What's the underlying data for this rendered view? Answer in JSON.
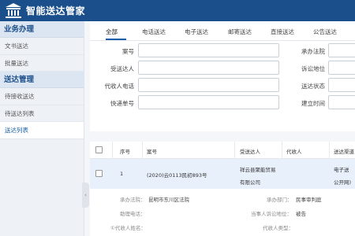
{
  "app": {
    "title": "智能送达管家"
  },
  "sidebar": {
    "sections": [
      {
        "label": "业务办理",
        "items": [
          {
            "label": "文书送达"
          },
          {
            "label": "批量送达"
          }
        ]
      },
      {
        "label": "送达管理",
        "items": [
          {
            "label": "待接收送达"
          },
          {
            "label": "待送达列表"
          },
          {
            "label": "送达列表"
          }
        ]
      }
    ],
    "active_item": "送达列表",
    "collapse_glyph": "‹"
  },
  "tabs": [
    "全部",
    "电话送达",
    "电子送达",
    "邮寄送达",
    "直接送达",
    "公告送达"
  ],
  "active_tab": "全部",
  "form": {
    "case_no": "案号",
    "recipient": "受送达人",
    "agent_phone": "代收人电话",
    "tracking_no": "快递单号",
    "court": "承办法院",
    "litigation_status": "诉讼地位",
    "delivery_status": "送达状态",
    "created_time": "建立时间"
  },
  "table": {
    "headers": [
      "序号",
      "案号",
      "受送达人",
      "代收人",
      "送达渠道"
    ],
    "rows": [
      {
        "index": "1",
        "case_no": "(2020)云0113民初893号",
        "recipient_line1": "祥云县聚能贸易",
        "recipient_line2": "有限公司",
        "agent": "",
        "channel_line1": "电子送",
        "channel_line2": "公开网)"
      }
    ],
    "detail": {
      "court_label": "承办法院：",
      "court_value": "昆明市东川区法院",
      "department_label": "承办部门：",
      "department_value": "民事审判庭",
      "clerk_label": "助理电话：",
      "clerk_value": "",
      "party_status_label": "当事人诉讼地位：",
      "party_status_value": "被告",
      "agent_name_label": "①代收人姓名：",
      "agent_name_value": "",
      "agent_type_label": "代收人类型：",
      "agent_type_value": ""
    }
  },
  "colors": {
    "header_bg": "#1a4f8b",
    "accent": "#1a5fa8",
    "row_highlight": "#e8f1fb"
  },
  "icons": {
    "logo": "courthouse-icon"
  }
}
